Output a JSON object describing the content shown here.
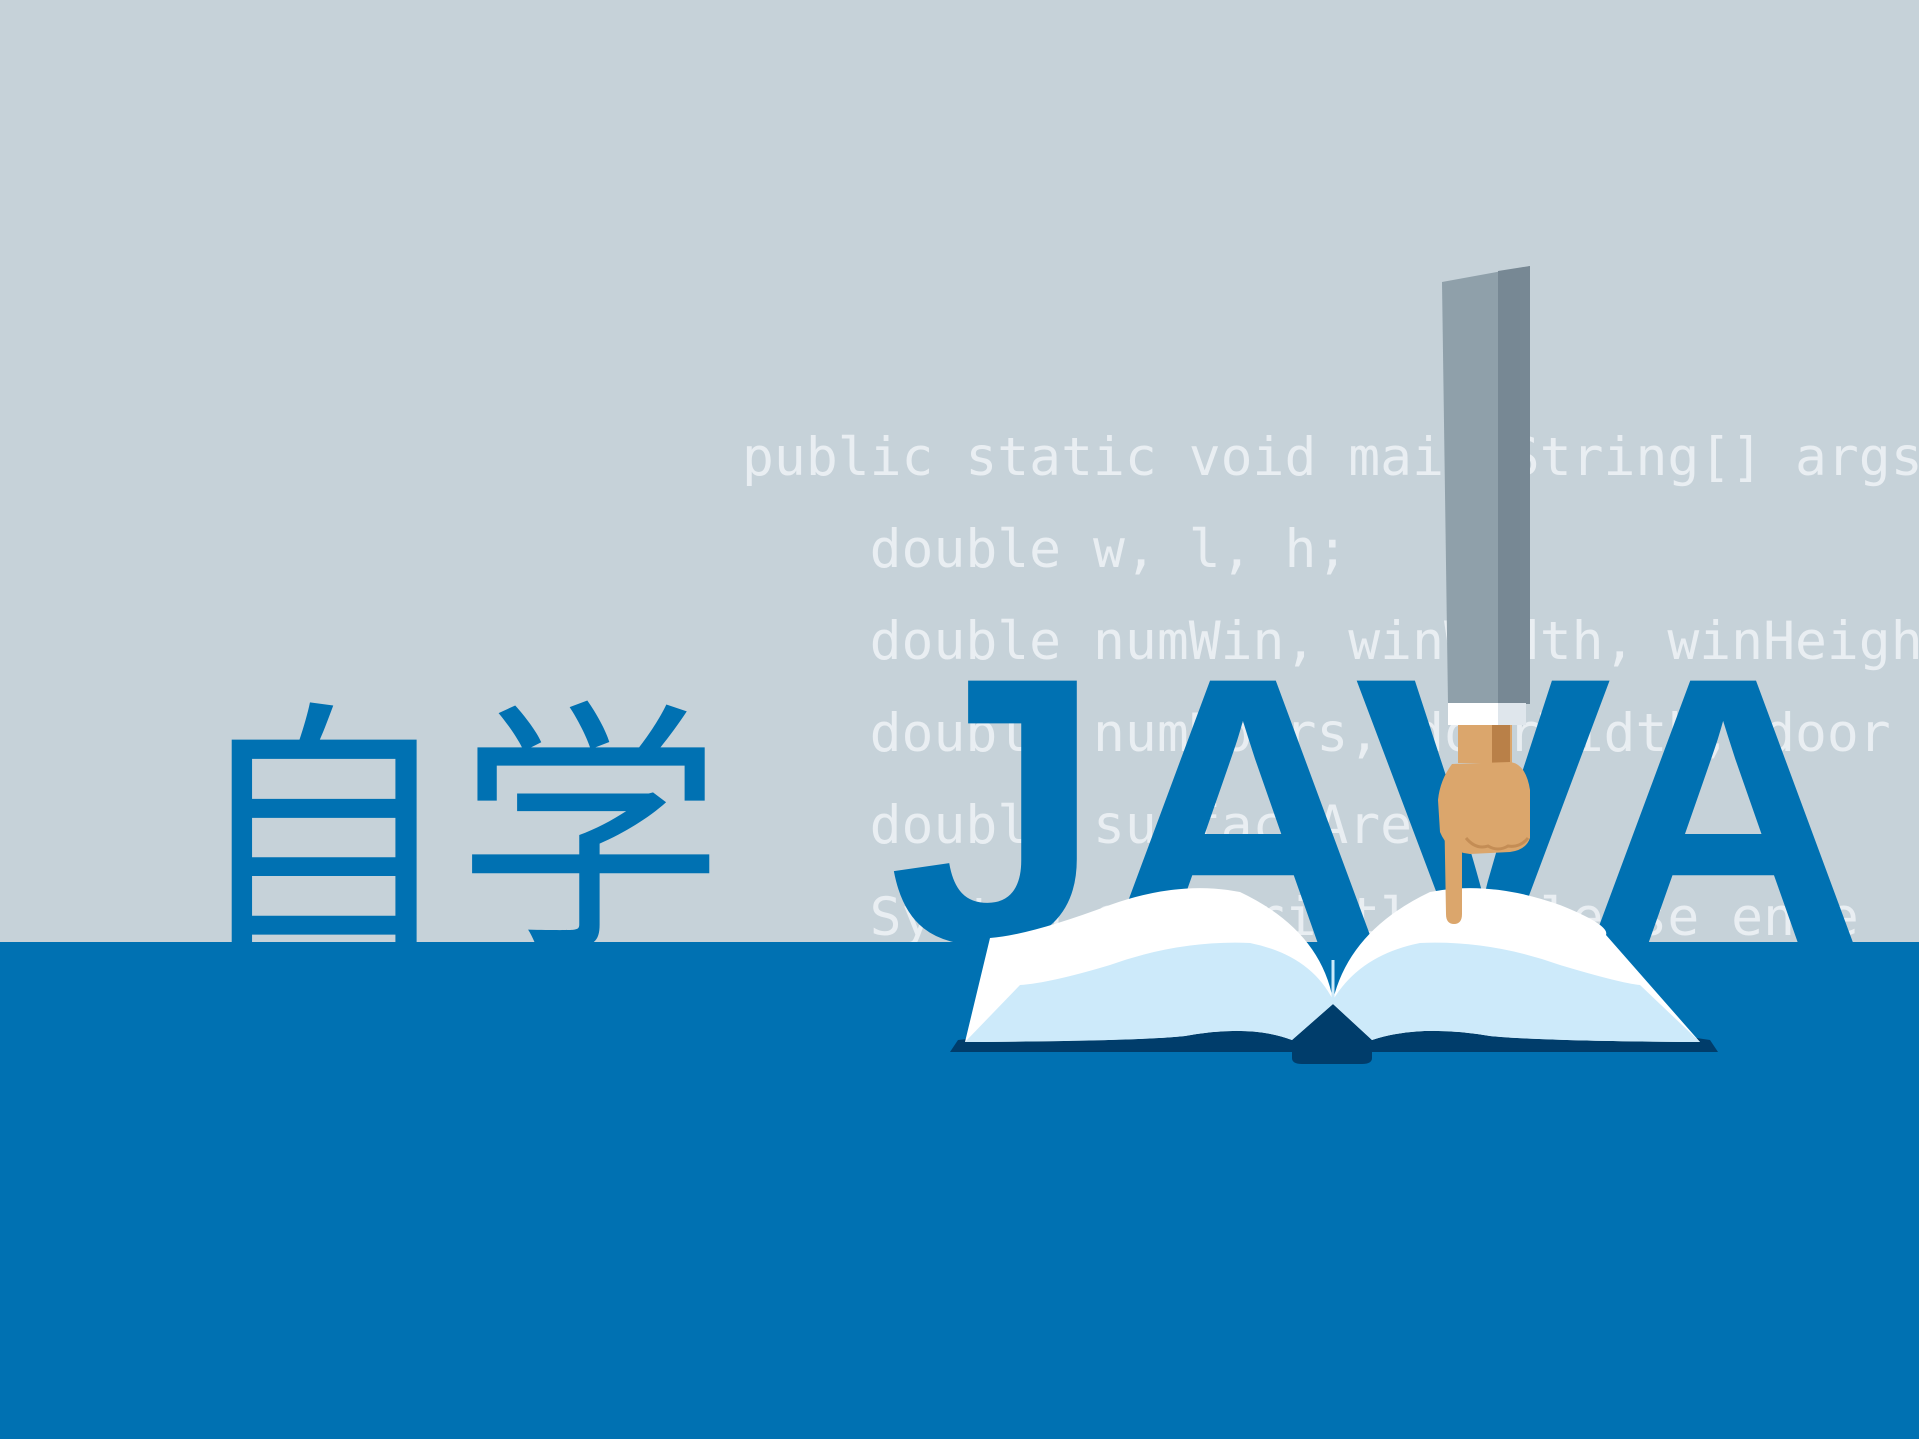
{
  "title": {
    "chinese": "自学",
    "java": "JAVA"
  },
  "code_lines": [
    "public static void main(String[] args",
    "    double w, l, h;",
    "    double numWin, winWidth, winHeight",
    "    double numDoors, doorWidth, door",
    "    double surfaceArea",
    "    System.out.println(\"Please ente"
  ],
  "colors": {
    "background": "#c6d2d9",
    "brand_blue": "#0071b2",
    "code_text": "#e9eef2",
    "book_page": "#ffffff",
    "book_page_shade": "#cdeafa",
    "book_cover": "#003d6b",
    "sleeve": "#8fa0aa",
    "sleeve_shadow": "#778894",
    "skin": "#dba66c",
    "skin_shadow": "#b98048"
  },
  "icons": {
    "book": "open-book-icon",
    "hand": "pointing-hand-icon"
  }
}
